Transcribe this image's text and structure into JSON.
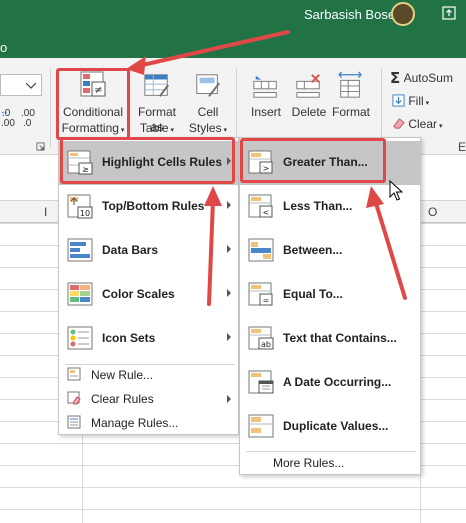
{
  "titlebar": {
    "left_fragment": "o",
    "user_name": "Sarbasish Bose"
  },
  "ribbon": {
    "conditional_formatting": {
      "line1": "Conditional",
      "line2": "Formatting"
    },
    "format_as_table": {
      "line1": "Format as",
      "line2": "Table"
    },
    "cell_styles": {
      "line1": "Cell",
      "line2": "Styles"
    },
    "insert": "Insert",
    "delete": "Delete",
    "format": "Format",
    "autosum": "AutoSum",
    "fill": "Fill",
    "clear": "Clear",
    "number_fragment_1": ".0",
    "number_fragment_2": ".00",
    "number_fragment_3": ".00",
    "number_fragment_4": ".0",
    "right_edge_fragment": "E"
  },
  "columns": [
    "I",
    "O"
  ],
  "cf_menu": {
    "items": [
      {
        "label": "Highlight Cells Rules",
        "icon": "highlight-cells-icon",
        "submenu": true
      },
      {
        "label": "Top/Bottom Rules",
        "icon": "top-bottom-icon",
        "submenu": true
      },
      {
        "label": "Data Bars",
        "icon": "data-bars-icon",
        "submenu": true
      },
      {
        "label": "Color Scales",
        "icon": "color-scales-icon",
        "submenu": true
      },
      {
        "label": "Icon Sets",
        "icon": "icon-sets-icon",
        "submenu": true
      }
    ],
    "small_items": [
      {
        "label": "New Rule...",
        "icon": "new-rule-icon"
      },
      {
        "label": "Clear Rules",
        "icon": "clear-rules-icon",
        "submenu": true
      },
      {
        "label": "Manage Rules...",
        "icon": "manage-rules-icon"
      }
    ]
  },
  "highlight_submenu": {
    "items": [
      {
        "label": "Greater Than...",
        "icon": "greater-than-icon"
      },
      {
        "label": "Less Than...",
        "icon": "less-than-icon"
      },
      {
        "label": "Between...",
        "icon": "between-icon"
      },
      {
        "label": "Equal To...",
        "icon": "equal-to-icon"
      },
      {
        "label": "Text that Contains...",
        "icon": "text-contains-icon"
      },
      {
        "label": "A Date Occurring...",
        "icon": "date-occurring-icon"
      },
      {
        "label": "Duplicate Values...",
        "icon": "duplicate-values-icon"
      }
    ],
    "more_rules": "More Rules..."
  },
  "colors": {
    "title_bar": "#217346",
    "annotation_red": "#e04848",
    "selected_item": "#c6c6c6"
  }
}
